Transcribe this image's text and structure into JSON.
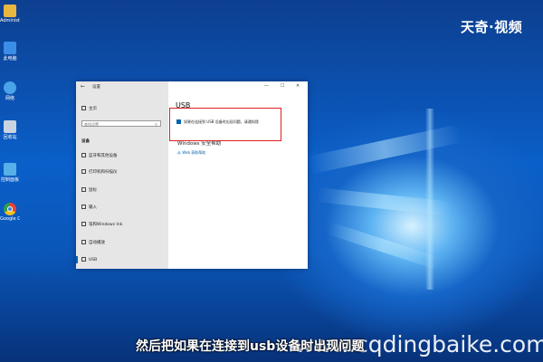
{
  "brand": "天奇·视频",
  "site_watermark": "www.cqdingbaike.com",
  "subtitle": "然后把如果在连接到usb设备时出现问题",
  "desktop_icons": [
    {
      "label": "Administrator",
      "color": "#e8b740",
      "icon": "folder-icon"
    },
    {
      "label": "此电脑",
      "color": "#3a8ee6",
      "icon": "computer-icon"
    },
    {
      "label": "网络",
      "color": "#4aa3e8",
      "icon": "network-icon"
    },
    {
      "label": "回收站",
      "color": "#c8d4e0",
      "icon": "recycle-bin-icon"
    },
    {
      "label": "控制面板",
      "color": "#57b0e8",
      "icon": "control-panel-icon"
    },
    {
      "label": "Google Chrome",
      "color": "#e84335",
      "icon": "chrome-icon"
    }
  ],
  "window": {
    "back": "←",
    "title": "设置",
    "minimize": "—",
    "maximize": "☐",
    "close": "✕",
    "home": "主页",
    "search_placeholder": "查找设置",
    "section": "设备",
    "nav": [
      {
        "label": "蓝牙和其他设备",
        "icon": "bluetooth-icon"
      },
      {
        "label": "打印机和扫描仪",
        "icon": "printer-icon"
      },
      {
        "label": "鼠标",
        "icon": "mouse-icon"
      },
      {
        "label": "输入",
        "icon": "keyboard-icon"
      },
      {
        "label": "笔和Windows Ink",
        "icon": "pen-icon"
      },
      {
        "label": "自动播放",
        "icon": "autoplay-icon"
      },
      {
        "label": "USB",
        "icon": "usb-icon"
      }
    ],
    "page_title": "USB",
    "checkbox_label": "如果在连接到 USB 设备时出现问题，请通知我",
    "help_heading": "Windows 安全帮助",
    "help_link": "从 Web 获取帮助"
  }
}
